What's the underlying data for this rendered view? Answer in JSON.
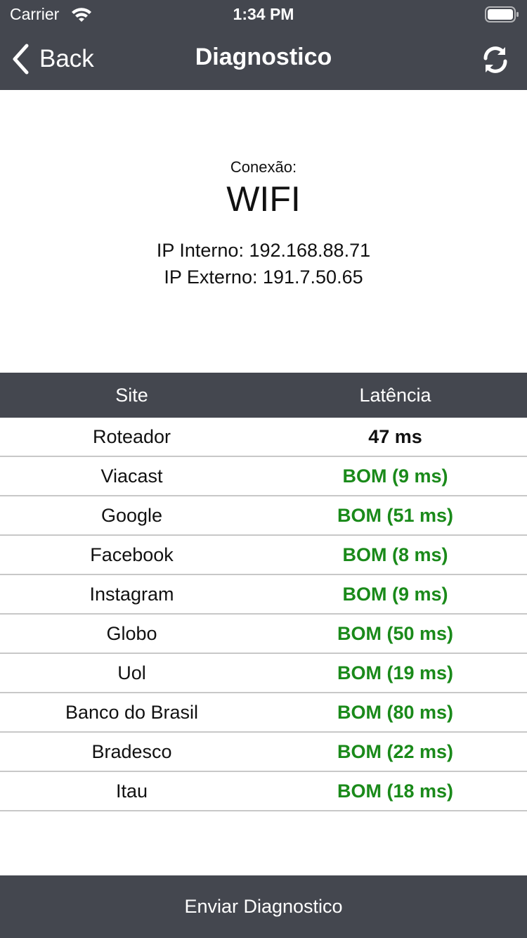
{
  "status_bar": {
    "carrier": "Carrier",
    "time": "1:34 PM"
  },
  "navbar": {
    "back_label": "Back",
    "title": "Diagnostico",
    "back_icon": "chevron-left-icon",
    "refresh_icon": "refresh-icon"
  },
  "connection": {
    "label": "Conexão:",
    "type": "WIFI",
    "ip_internal": "IP Interno: 192.168.88.71",
    "ip_external": "IP Externo: 191.7.50.65"
  },
  "table": {
    "columns": [
      "Site",
      "Latência"
    ],
    "rows": [
      {
        "site": "Roteador",
        "latency": "47 ms",
        "status": "neutral"
      },
      {
        "site": "Viacast",
        "latency": "BOM (9 ms)",
        "status": "good"
      },
      {
        "site": "Google",
        "latency": "BOM (51 ms)",
        "status": "good"
      },
      {
        "site": "Facebook",
        "latency": "BOM (8 ms)",
        "status": "good"
      },
      {
        "site": "Instagram",
        "latency": "BOM (9 ms)",
        "status": "good"
      },
      {
        "site": "Globo",
        "latency": "BOM (50 ms)",
        "status": "good"
      },
      {
        "site": "Uol",
        "latency": "BOM (19 ms)",
        "status": "good"
      },
      {
        "site": "Banco do Brasil",
        "latency": "BOM (80 ms)",
        "status": "good"
      },
      {
        "site": "Bradesco",
        "latency": "BOM (22 ms)",
        "status": "good"
      },
      {
        "site": "Itau",
        "latency": "BOM (18 ms)",
        "status": "good"
      }
    ]
  },
  "footer": {
    "button_label": "Enviar Diagnostico"
  },
  "colors": {
    "bar_background": "#44474f",
    "good": "#1a8a1a",
    "neutral": "#111111",
    "divider": "#c8c8c8"
  }
}
